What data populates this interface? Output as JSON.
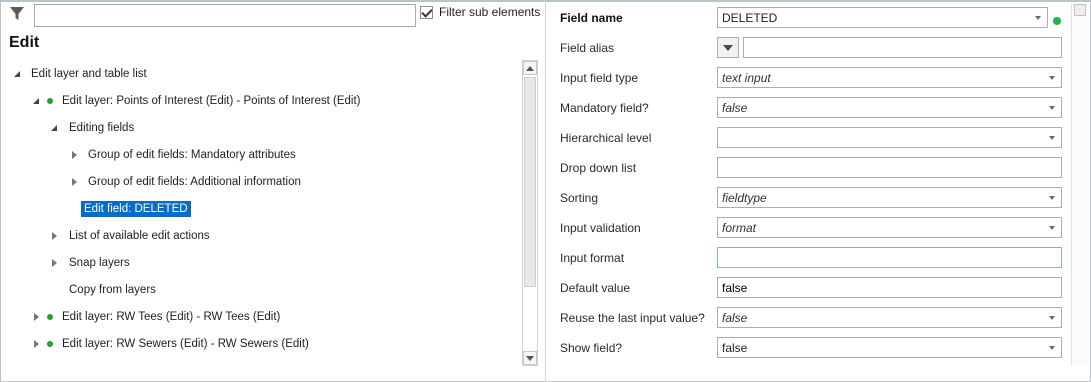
{
  "filter": {
    "input_value": "",
    "checkbox_label": "Filter sub elements",
    "checkbox_checked": true
  },
  "panel_title": "Edit",
  "tree": [
    {
      "label": "Edit layer and table list",
      "expander": "open",
      "dot": false,
      "selected": false
    },
    {
      "label": "Edit layer: Points of Interest (Edit) - Points of Interest (Edit)",
      "expander": "open",
      "dot": true,
      "selected": false
    },
    {
      "label": "Editing fields",
      "expander": "open",
      "dot": false,
      "selected": false
    },
    {
      "label": "Group of edit fields: Mandatory attributes",
      "expander": "closed",
      "dot": false,
      "selected": false
    },
    {
      "label": "Group of edit fields: Additional information",
      "expander": "closed",
      "dot": false,
      "selected": false
    },
    {
      "label": "Edit field: DELETED",
      "expander": "none",
      "dot": false,
      "selected": true
    },
    {
      "label": "List of available edit actions",
      "expander": "closed",
      "dot": false,
      "selected": false
    },
    {
      "label": "Snap layers",
      "expander": "closed",
      "dot": false,
      "selected": false
    },
    {
      "label": "Copy from layers",
      "expander": "none",
      "dot": false,
      "selected": false
    },
    {
      "label": "Edit layer: RW Tees (Edit) - RW Tees (Edit)",
      "expander": "closed",
      "dot": true,
      "selected": false
    },
    {
      "label": "Edit layer: RW Sewers (Edit) - RW Sewers (Edit)",
      "expander": "closed",
      "dot": true,
      "selected": false
    }
  ],
  "properties": {
    "field_name": {
      "label": "Field name",
      "value": "DELETED"
    },
    "field_alias": {
      "label": "Field alias",
      "value": ""
    },
    "input_field_type": {
      "label": "Input field type",
      "value": "text input"
    },
    "mandatory_field": {
      "label": "Mandatory field?",
      "value": "false"
    },
    "hierarchical_level": {
      "label": "Hierarchical level",
      "value": ""
    },
    "drop_down_list": {
      "label": "Drop down list",
      "value": ""
    },
    "sorting": {
      "label": "Sorting",
      "value": "fieldtype"
    },
    "input_validation": {
      "label": "Input validation",
      "value": "format"
    },
    "input_format": {
      "label": "Input format",
      "value": ""
    },
    "default_value": {
      "label": "Default value",
      "value": "false"
    },
    "reuse_last_input": {
      "label": "Reuse the last input value?",
      "value": "false"
    },
    "show_field": {
      "label": "Show field?",
      "value": "false"
    }
  },
  "colors": {
    "selection": "#0a6cc2",
    "status_ok": "#22b14c",
    "tree_dot": "#22a32a"
  },
  "icons": {
    "filter": "funnel-icon",
    "status": "green-status-dot"
  }
}
